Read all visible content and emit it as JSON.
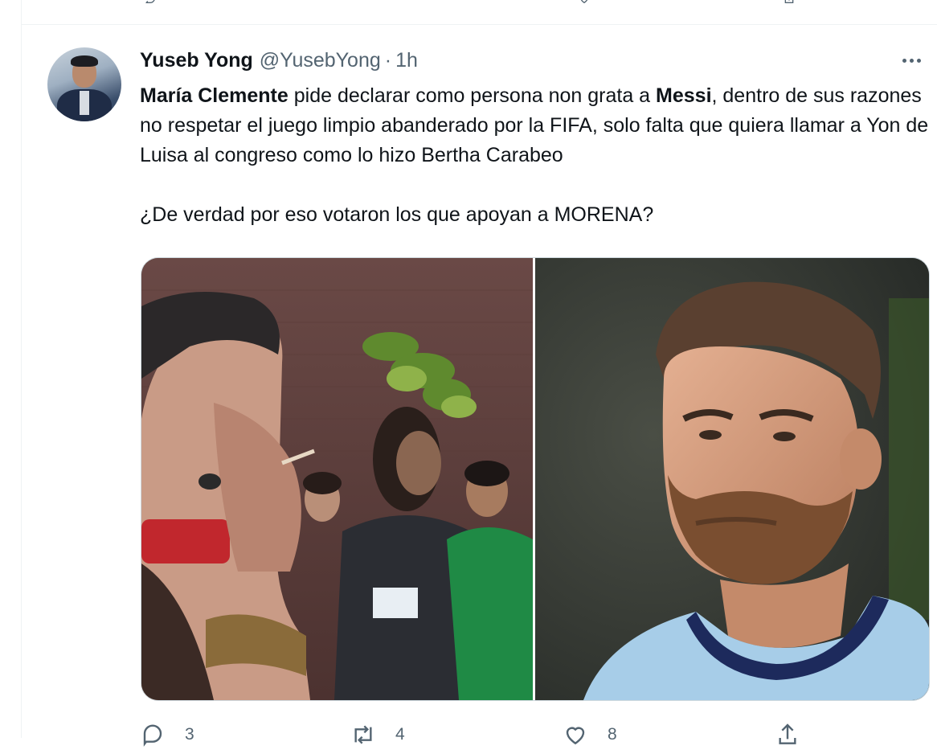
{
  "tweet": {
    "author_name": "Yuseb Yong",
    "author_handle": "@YusebYong",
    "separator": "·",
    "time": "1h",
    "text_bold_1": "María Clemente",
    "text_part_1": " pide declarar como persona non grata a ",
    "text_bold_2": "Messi",
    "text_part_2": ", dentro de sus razones no respetar el juego limpio abanderado por la FIFA, solo falta que quiera llamar a Yon de Luisa al congreso como lo hizo Bertha Carabeo",
    "text_paragraph_2": "¿De verdad por eso votaron los que apoyan a MORENA?",
    "icons": {
      "more": "more-dots-icon",
      "reply": "reply-icon",
      "retweet": "retweet-icon",
      "like": "heart-icon",
      "share": "share-icon"
    },
    "counts": {
      "replies": "3",
      "retweets": "4",
      "likes": "8"
    }
  },
  "colors": {
    "text_primary": "#0f1419",
    "text_secondary": "#536471",
    "border": "#eff3f4"
  }
}
